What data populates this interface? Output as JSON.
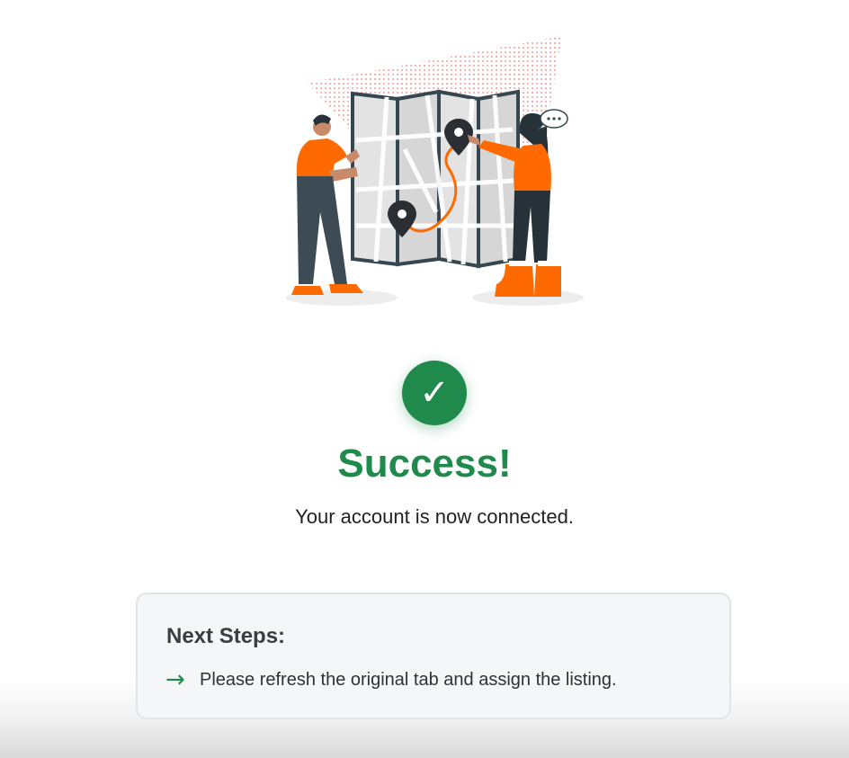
{
  "illustration": {
    "icon": "map-navigation-illustration",
    "colors": {
      "accent": "#ff6a00",
      "dark": "#37474f",
      "map": "#dedede"
    }
  },
  "status": {
    "icon": "checkmark-icon",
    "icon_glyph": "✓",
    "color": "#1f8a4c",
    "title": "Success!",
    "message": "Your account is now connected."
  },
  "next_steps": {
    "title": "Next Steps:",
    "arrow_glyph": "→",
    "items": [
      {
        "text": "Please refresh the original tab and assign the listing."
      }
    ]
  }
}
